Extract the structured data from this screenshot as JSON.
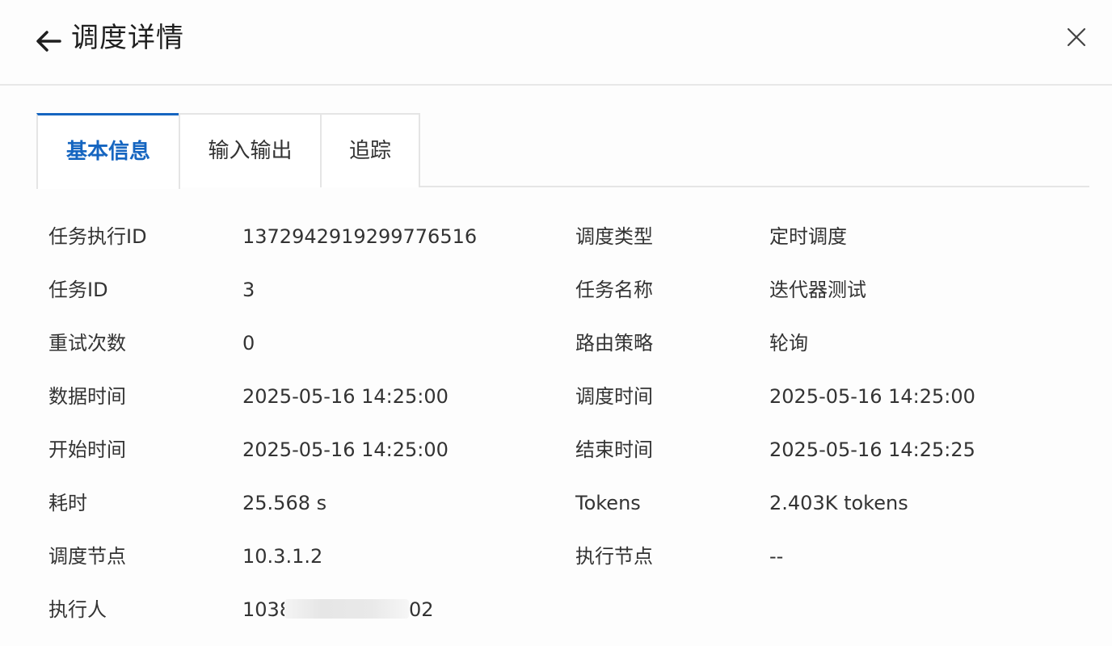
{
  "header": {
    "title": "调度详情"
  },
  "tabs": [
    {
      "label": "基本信息",
      "active": true
    },
    {
      "label": "输入输出",
      "active": false
    },
    {
      "label": "追踪",
      "active": false
    }
  ],
  "details": {
    "task_exec_id": {
      "label": "任务执行ID",
      "value": "1372942919299776516"
    },
    "schedule_type": {
      "label": "调度类型",
      "value": "定时调度"
    },
    "task_id": {
      "label": "任务ID",
      "value": "3"
    },
    "task_name": {
      "label": "任务名称",
      "value": "迭代器测试"
    },
    "retry_count": {
      "label": "重试次数",
      "value": "0"
    },
    "routing_strategy": {
      "label": "路由策略",
      "value": "轮询"
    },
    "data_time": {
      "label": "数据时间",
      "value": "2025-05-16 14:25:00"
    },
    "schedule_time": {
      "label": "调度时间",
      "value": "2025-05-16 14:25:00"
    },
    "start_time": {
      "label": "开始时间",
      "value": "2025-05-16 14:25:00"
    },
    "end_time": {
      "label": "结束时间",
      "value": "2025-05-16 14:25:25"
    },
    "duration": {
      "label": "耗时",
      "value": "25.568 s"
    },
    "tokens": {
      "label": "Tokens",
      "value": "2.403K tokens"
    },
    "schedule_node": {
      "label": "调度节点",
      "value": "10.3.1.2"
    },
    "exec_node": {
      "label": "执行节点",
      "value": "--"
    },
    "executor": {
      "label": "执行人",
      "value_prefix": "1038",
      "value_suffix": "02"
    }
  },
  "colors": {
    "accent": "#1565c0",
    "text": "#333333",
    "border": "#e5e5e5"
  }
}
